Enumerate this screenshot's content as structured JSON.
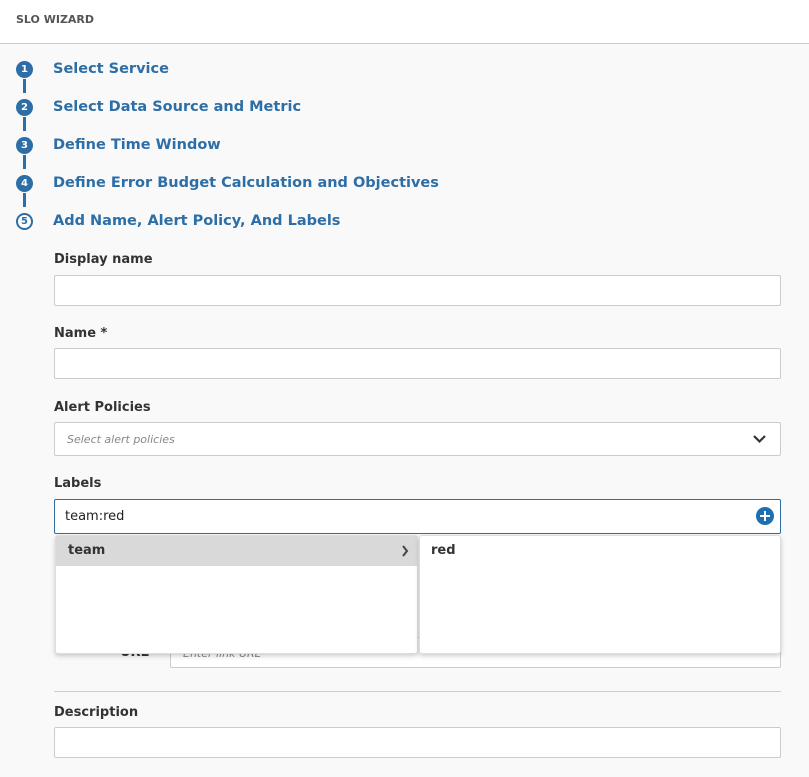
{
  "header": {
    "title": "SLO WIZARD"
  },
  "steps": [
    {
      "num": "1",
      "label": "Select Service"
    },
    {
      "num": "2",
      "label": "Select Data Source and Metric"
    },
    {
      "num": "3",
      "label": "Define Time Window"
    },
    {
      "num": "4",
      "label": "Define Error Budget Calculation and Objectives"
    },
    {
      "num": "5",
      "label": "Add Name, Alert Policy, And Labels"
    }
  ],
  "form": {
    "display_name_label": "Display name",
    "display_name_value": "",
    "name_label": "Name *",
    "name_value": "",
    "alert_label": "Alert Policies",
    "alert_placeholder": "Select alert policies",
    "labels_label": "Labels",
    "labels_value": "team:red",
    "label_keys": [
      "team"
    ],
    "label_values": [
      "red"
    ],
    "url_label": "URL",
    "url_placeholder": "Enter link URL",
    "description_label": "Description",
    "description_value": ""
  },
  "colors": {
    "accent": "#2d6ea6",
    "input_focus": "#2d6ea6"
  }
}
